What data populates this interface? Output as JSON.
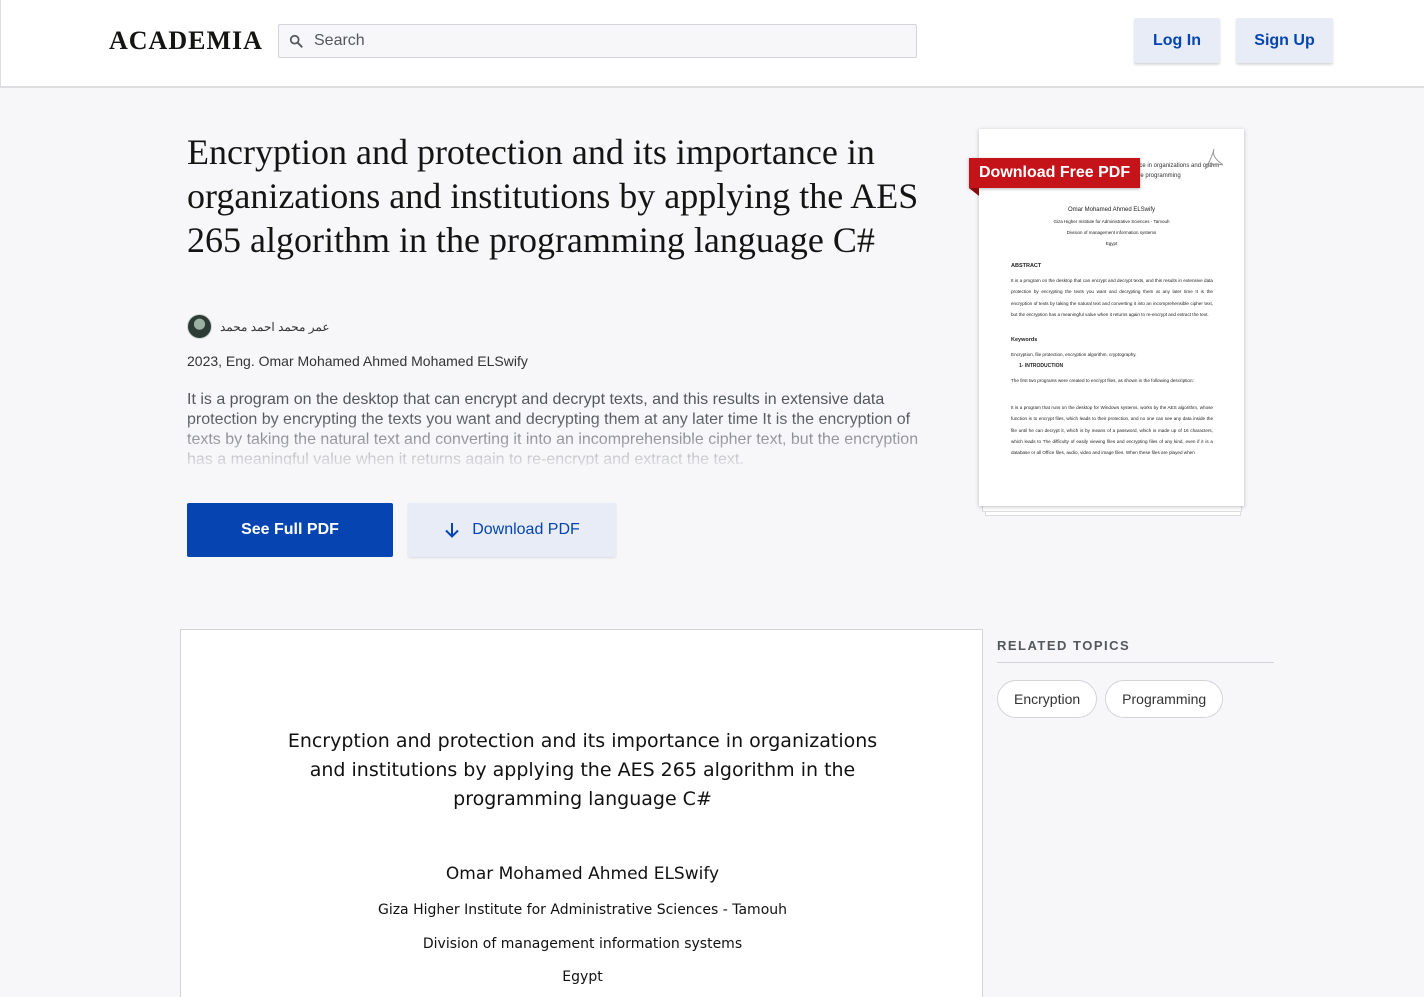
{
  "header": {
    "logo": "ACADEMIA",
    "search_placeholder": "Search",
    "login_label": "Log In",
    "signup_label": "Sign Up"
  },
  "paper": {
    "title": "Encryption and protection and its importance in organizations and institutions by applying the AES 265 algorithm in the programming language C#",
    "author_name": "عمر محمد احمد محمد",
    "meta": "2023, Eng. Omar Mohamed Ahmed Mohamed ELSwify",
    "abstract": "It is a program on the desktop that can encrypt and decrypt texts, and this results in extensive data protection by encrypting the texts you want and decrypting them at any later time It is the encryption of texts by taking the natural text and converting it into an incomprehensible cipher text, but the encryption has a meaningful value when it returns again to re-encrypt and extract the text.",
    "see_full_label": "See Full PDF",
    "download_label": "Download PDF"
  },
  "thumbnail": {
    "ribbon_label": "Download Free PDF",
    "header_text": "rtance in organizations and orithm in the programming",
    "author": "Omar Mohamed Ahmed ELSwify",
    "institute": "Giza Higher Institute for Administrative Sciences - Tamouh",
    "division": "Division of management information systems",
    "country": "Egypt",
    "abstract_heading": "ABSTRACT",
    "abstract_text": "It is a program on the desktop that can encrypt and decrypt texts, and this results in extensive data protection by encrypting the texts you want and decrypting them at any later time It is the encryption of texts by taking the natural text and converting it into an incomprehensible cipher text, but the encryption has a meaningful value when it returns again to re-encrypt and extract the text.",
    "keywords_heading": "Keywords",
    "keywords_text": "Encryption, file protection, encryption algorithm, cryptography.",
    "intro_heading": "1-  INTRODUCTION",
    "intro_text": "The first two programs were created to encrypt files, as shown in the following description:",
    "body_text": "It is a program that runs on the desktop for Windows systems, works by the AES algorithm, whose function is to encrypt files, which leads to their protection, and no one can see any data inside the file until he can decrypt it, which is by means of a password, which is made up of 16 characters, which leads to The difficulty of easily viewing files and encrypting files of any kind, even if it is a database or all Office files, audio, video and image files. When these files are played when"
  },
  "document": {
    "title": "Encryption and protection and its importance in organizations and institutions by applying the AES 265 algorithm in the programming language C#",
    "author": "Omar Mohamed Ahmed ELSwify",
    "institute": "Giza Higher Institute for Administrative Sciences - Tamouh",
    "division": "Division of management information systems",
    "country": "Egypt"
  },
  "related": {
    "heading": "RELATED TOPICS",
    "topics": [
      "Encryption",
      "Programming"
    ]
  },
  "colors": {
    "brand_blue": "#0645b1",
    "button_light": "#e7ecf6",
    "ribbon_red": "#c4141a",
    "page_bg": "#f7f7f9"
  },
  "icons": {
    "search": "search-icon",
    "download": "download-arrow-icon",
    "pdf": "pdf-icon"
  }
}
